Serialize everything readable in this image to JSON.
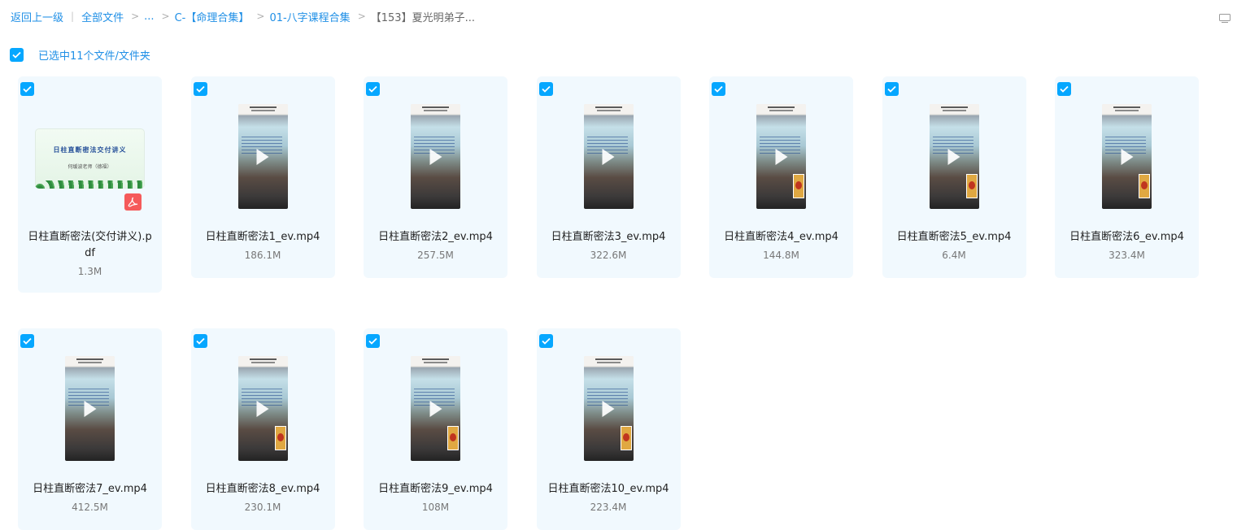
{
  "breadcrumb": {
    "back": "返回上一级",
    "all_files": "全部文件",
    "ellipsis": "...",
    "folder1": "C-【命理合集】",
    "folder2": "01-八字课程合集",
    "current": "【153】夏光明弟子..."
  },
  "toolbar": {
    "view_toggle_icon": "list-view-icon"
  },
  "selection": {
    "label": "已选中11个文件/文件夹"
  },
  "pdf_thumbnail": {
    "title": "日柱直断密法交付讲义",
    "subtitle": "何缓波老师（德福）"
  },
  "colors": {
    "accent": "#06a7ff",
    "link": "#1f8fe6",
    "card_bg": "#f1f9fe",
    "pdf_badge": "#f55a5a"
  },
  "files": [
    {
      "name": "日柱直断密法(交付讲义).pdf",
      "size": "1.3M",
      "type": "pdf",
      "selected": true
    },
    {
      "name": "日柱直断密法1_ev.mp4",
      "size": "186.1M",
      "type": "video",
      "selected": true
    },
    {
      "name": "日柱直断密法2_ev.mp4",
      "size": "257.5M",
      "type": "video",
      "selected": true
    },
    {
      "name": "日柱直断密法3_ev.mp4",
      "size": "322.6M",
      "type": "video",
      "selected": true
    },
    {
      "name": "日柱直断密法4_ev.mp4",
      "size": "144.8M",
      "type": "video",
      "selected": true
    },
    {
      "name": "日柱直断密法5_ev.mp4",
      "size": "6.4M",
      "type": "video",
      "selected": true
    },
    {
      "name": "日柱直断密法6_ev.mp4",
      "size": "323.4M",
      "type": "video",
      "selected": true
    },
    {
      "name": "日柱直断密法7_ev.mp4",
      "size": "412.5M",
      "type": "video",
      "selected": true
    },
    {
      "name": "日柱直断密法8_ev.mp4",
      "size": "230.1M",
      "type": "video",
      "selected": true
    },
    {
      "name": "日柱直断密法9_ev.mp4",
      "size": "108M",
      "type": "video",
      "selected": true
    },
    {
      "name": "日柱直断密法10_ev.mp4",
      "size": "223.4M",
      "type": "video",
      "selected": true
    }
  ]
}
